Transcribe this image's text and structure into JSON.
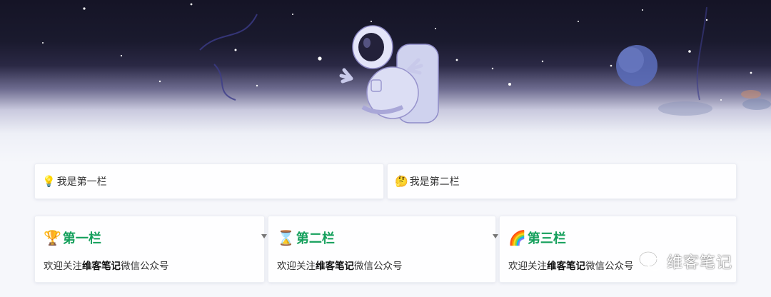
{
  "top_bar": [
    {
      "emoji": "💡",
      "label": "我是第一栏"
    },
    {
      "emoji": "🤔",
      "label": "我是第二栏"
    }
  ],
  "columns": [
    {
      "emoji": "🏆",
      "title": "第一栏",
      "text_before": "欢迎关注",
      "text_bold": "维客笔记",
      "text_after": "微信公众号"
    },
    {
      "emoji": "⌛",
      "title": "第二栏",
      "text_before": "欢迎关注",
      "text_bold": "维客笔记",
      "text_after": "微信公众号"
    },
    {
      "emoji": "🌈",
      "title": "第三栏",
      "text_before": "欢迎关注",
      "text_bold": "维客笔记",
      "text_after": "微信公众号"
    }
  ],
  "watermark": {
    "text": "维客笔记",
    "icon": "wechat-icon"
  },
  "colors": {
    "title_green": "#15a05c",
    "sky_dark": "#151426"
  }
}
